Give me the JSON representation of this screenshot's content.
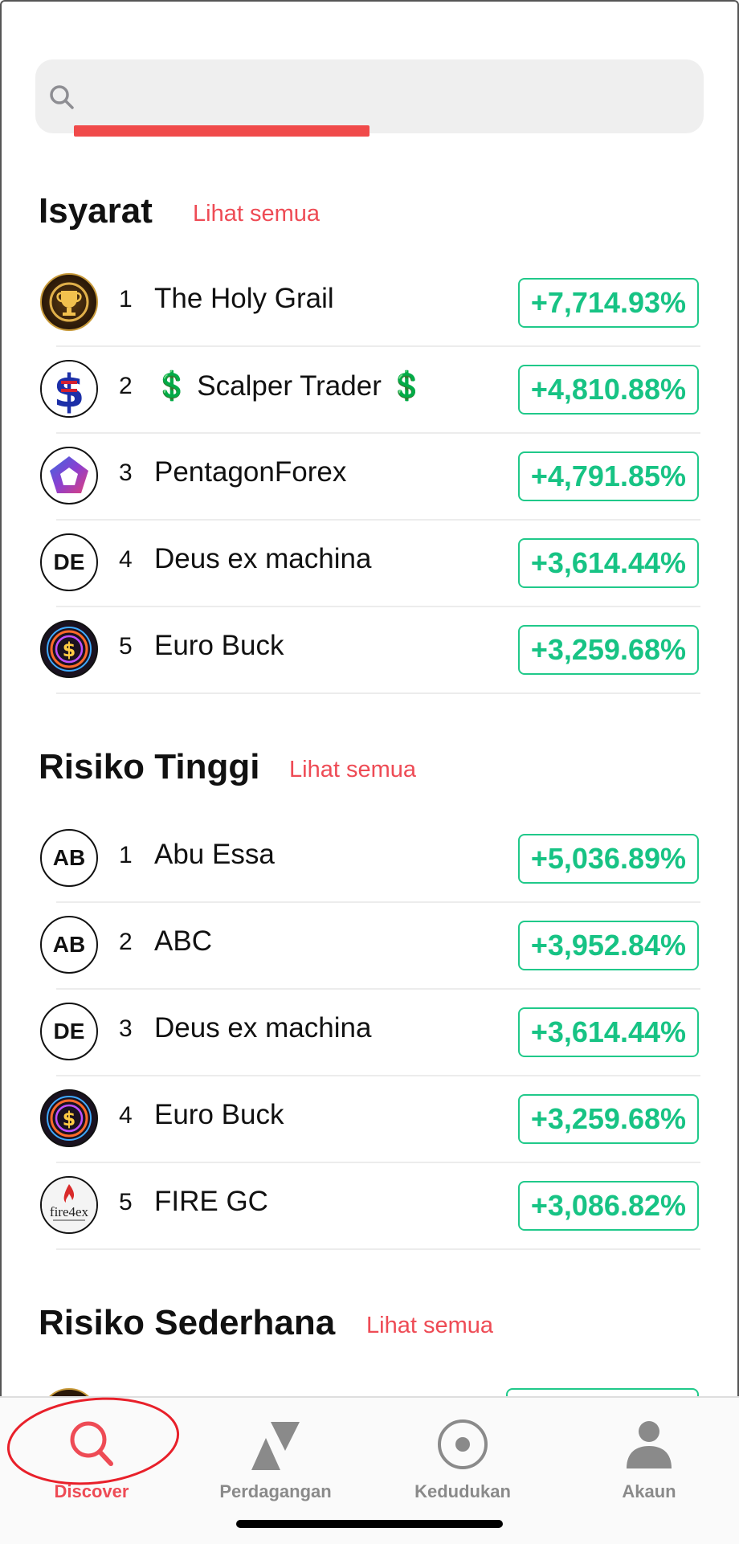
{
  "search": {
    "placeholder": "",
    "value": ""
  },
  "sections": [
    {
      "title": "Isyarat",
      "see_all": "Lihat semua",
      "items": [
        {
          "rank": "1",
          "name": "The Holy Grail",
          "gain": "+7,714.93%",
          "avatar": "trophy-icon",
          "initials": ""
        },
        {
          "rank": "2",
          "name": "💲 Scalper Trader 💲",
          "gain": "+4,810.88%",
          "avatar": "dollar-flag-icon",
          "initials": ""
        },
        {
          "rank": "3",
          "name": "PentagonForex",
          "gain": "+4,791.85%",
          "avatar": "pentagon-logo-icon",
          "initials": ""
        },
        {
          "rank": "4",
          "name": "Deus ex machina",
          "gain": "+3,614.44%",
          "avatar": "initials",
          "initials": "DE"
        },
        {
          "rank": "5",
          "name": "Euro Buck",
          "gain": "+3,259.68%",
          "avatar": "neon-dollar-icon",
          "initials": ""
        }
      ]
    },
    {
      "title": "Risiko Tinggi",
      "see_all": "Lihat semua",
      "items": [
        {
          "rank": "1",
          "name": "Abu Essa",
          "gain": "+5,036.89%",
          "avatar": "initials",
          "initials": "AB"
        },
        {
          "rank": "2",
          "name": "ABC",
          "gain": "+3,952.84%",
          "avatar": "initials",
          "initials": "AB"
        },
        {
          "rank": "3",
          "name": "Deus ex machina",
          "gain": "+3,614.44%",
          "avatar": "initials",
          "initials": "DE"
        },
        {
          "rank": "4",
          "name": "Euro Buck",
          "gain": "+3,259.68%",
          "avatar": "neon-dollar-icon",
          "initials": ""
        },
        {
          "rank": "5",
          "name": "FIRE GC",
          "gain": "+3,086.82%",
          "avatar": "fire4ex-logo-icon",
          "initials": "",
          "logo_text": "fire4ex"
        }
      ]
    },
    {
      "title": "Risiko Sederhana",
      "see_all": "Lihat semua",
      "items": []
    }
  ],
  "nav": {
    "tabs": [
      {
        "label": "Discover",
        "icon": "search-icon",
        "active": true
      },
      {
        "label": "Perdagangan",
        "icon": "trade-arrows-icon",
        "active": false
      },
      {
        "label": "Kedudukan",
        "icon": "position-target-icon",
        "active": false
      },
      {
        "label": "Akaun",
        "icon": "person-icon",
        "active": false
      }
    ]
  },
  "colors": {
    "accent_red": "#ee4b55",
    "gain_green": "#17c384",
    "search_bg": "#efefef"
  }
}
